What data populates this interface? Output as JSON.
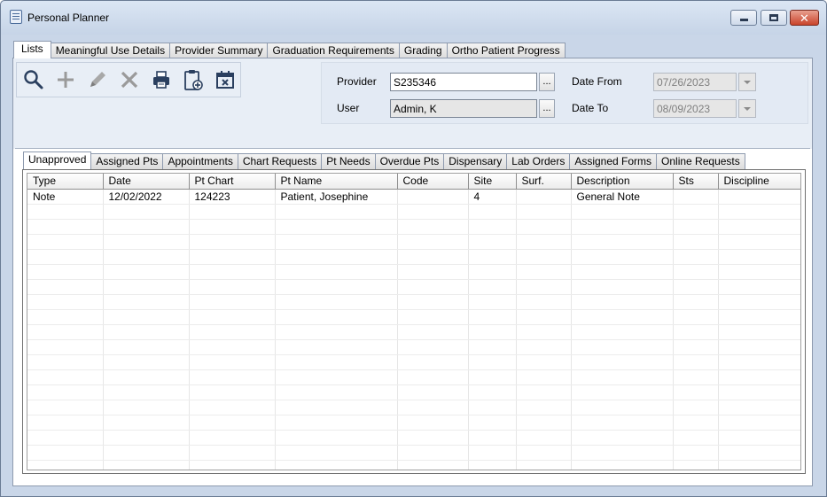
{
  "window": {
    "title": "Personal Planner"
  },
  "top_tabs": [
    {
      "label": "Lists",
      "active": true
    },
    {
      "label": "Meaningful Use Details",
      "active": false
    },
    {
      "label": "Provider Summary",
      "active": false
    },
    {
      "label": "Graduation Requirements",
      "active": false
    },
    {
      "label": "Grading",
      "active": false
    },
    {
      "label": "Ortho Patient Progress",
      "active": false
    }
  ],
  "toolbar": {
    "buttons": [
      {
        "icon": "search-icon"
      },
      {
        "icon": "add-icon"
      },
      {
        "icon": "edit-icon"
      },
      {
        "icon": "delete-icon"
      },
      {
        "icon": "print-icon"
      },
      {
        "icon": "clipboard-add-icon"
      },
      {
        "icon": "calendar-delete-icon"
      }
    ]
  },
  "filters": {
    "provider_label": "Provider",
    "provider_value": "S235346",
    "user_label": "User",
    "user_value": "Admin, K",
    "ellipsis": "...",
    "date_from_label": "Date From",
    "date_from_value": "07/26/2023",
    "date_to_label": "Date To",
    "date_to_value": "08/09/2023"
  },
  "inner_tabs": [
    {
      "label": "Unapproved",
      "active": true
    },
    {
      "label": "Assigned Pts",
      "active": false
    },
    {
      "label": "Appointments",
      "active": false
    },
    {
      "label": "Chart Requests",
      "active": false
    },
    {
      "label": "Pt Needs",
      "active": false
    },
    {
      "label": "Overdue Pts",
      "active": false
    },
    {
      "label": "Dispensary",
      "active": false
    },
    {
      "label": "Lab Orders",
      "active": false
    },
    {
      "label": "Assigned Forms",
      "active": false
    },
    {
      "label": "Online Requests",
      "active": false
    }
  ],
  "grid": {
    "columns": [
      "Type",
      "Date",
      "Pt Chart",
      "Pt Name",
      "Code",
      "Site",
      "Surf.",
      "Description",
      "Sts",
      "Discipline"
    ],
    "rows": [
      [
        "Note",
        "12/02/2022",
        "124223",
        "Patient, Josephine",
        "",
        "4",
        "",
        "General Note",
        "",
        ""
      ]
    ],
    "empty_row_count": 18
  },
  "colors": {
    "window_bg": "#c9d6e8",
    "panel_bg": "#e8eef6",
    "close_button": "#c9432b"
  }
}
